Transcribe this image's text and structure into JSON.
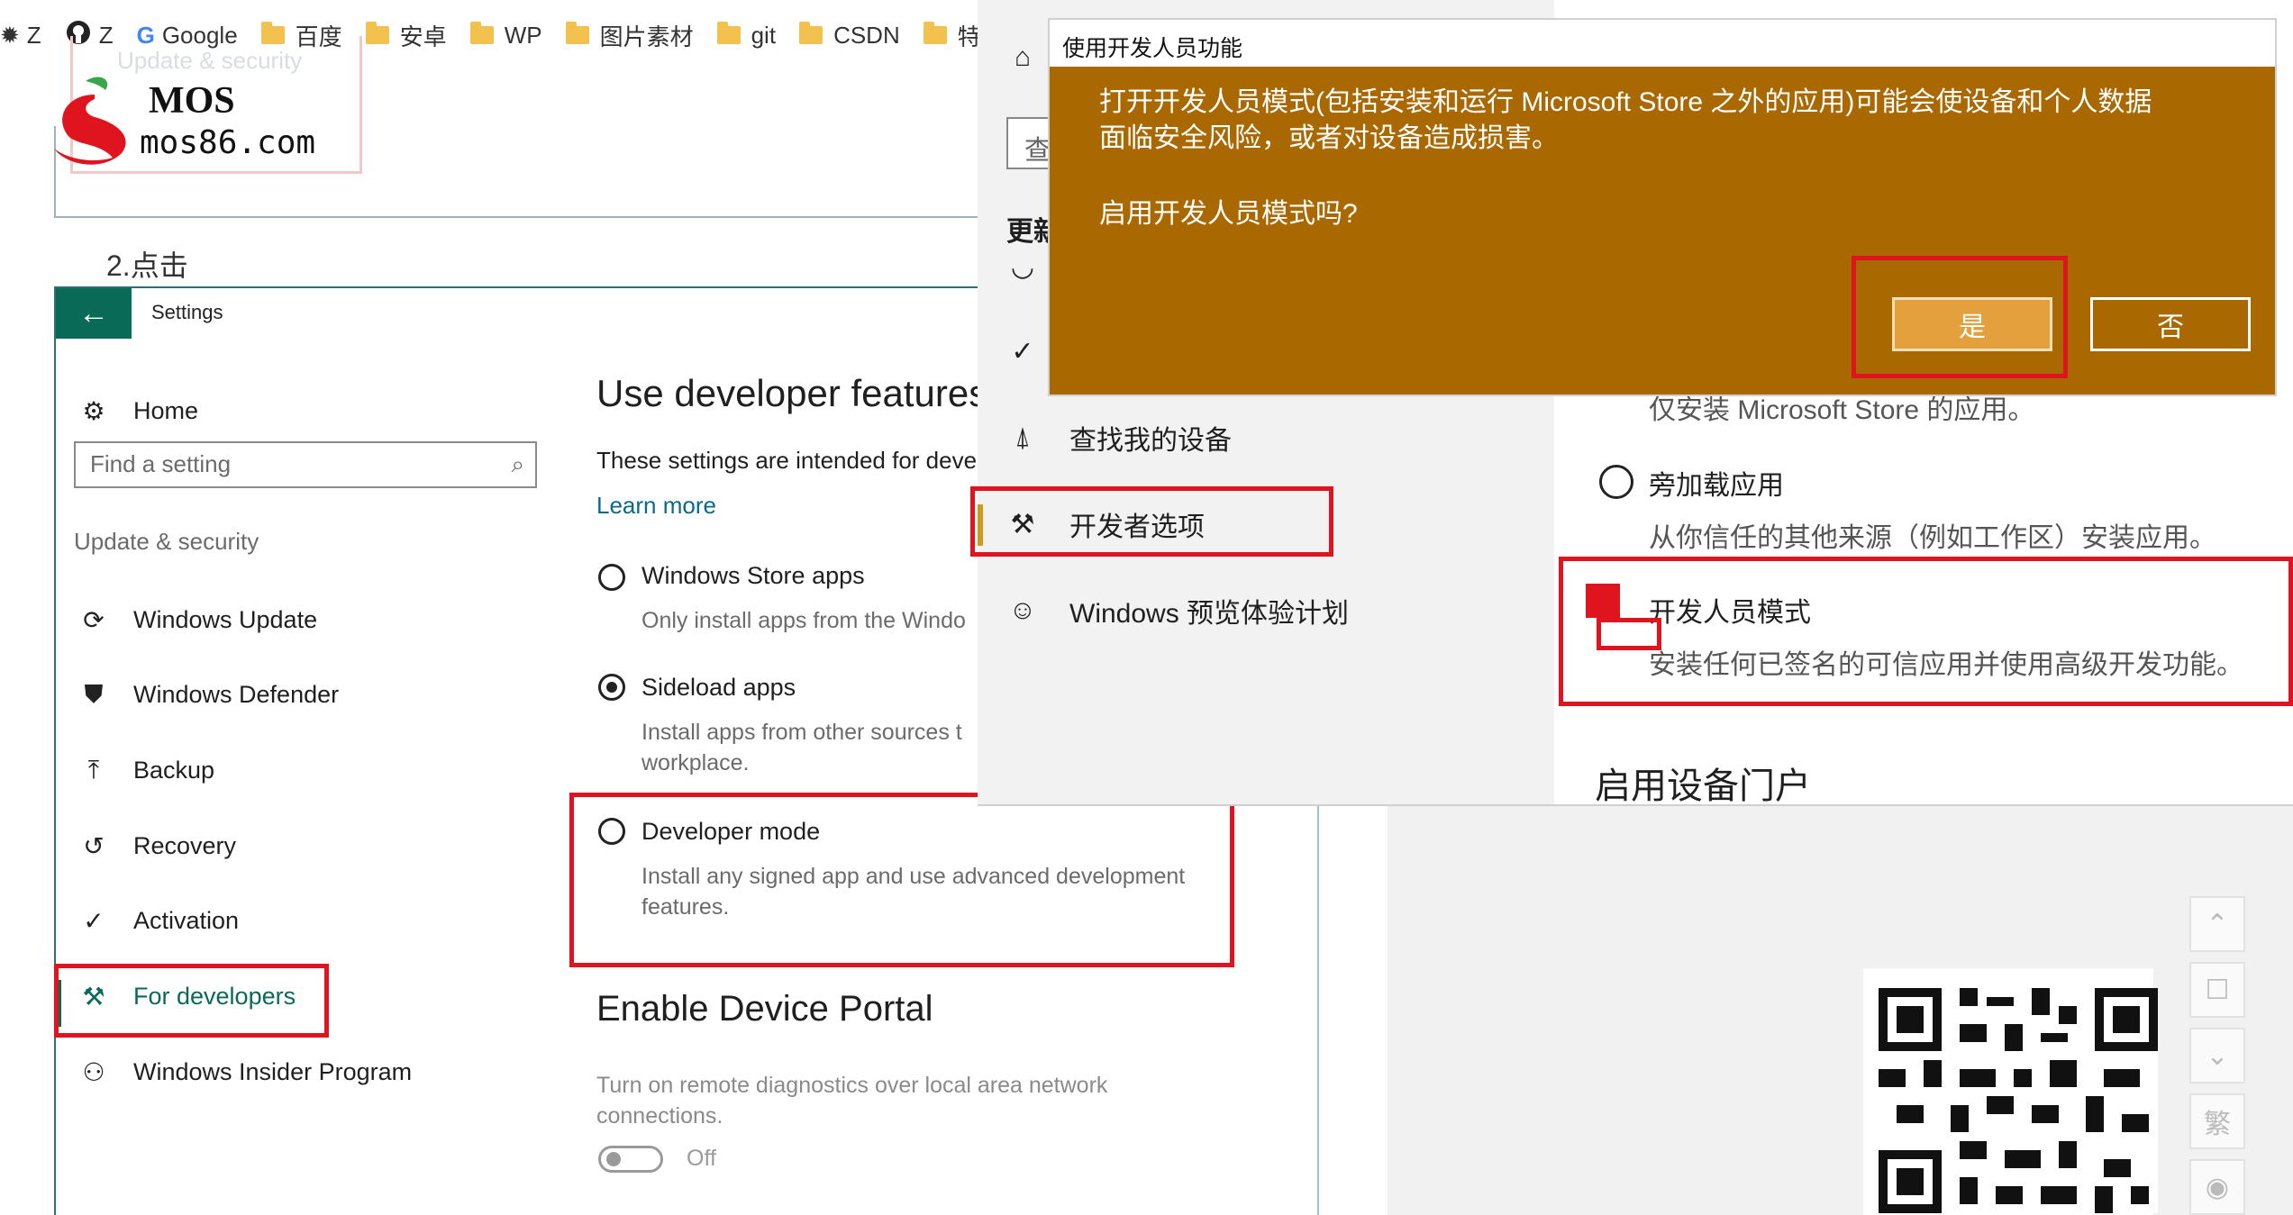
{
  "bookmarks": [
    {
      "label": "Z",
      "icon": "gear-icon"
    },
    {
      "label": "Z",
      "icon": "github-icon"
    },
    {
      "label": "Google",
      "icon": "google-icon"
    },
    {
      "label": "百度",
      "icon": "folder-icon"
    },
    {
      "label": "安卓",
      "icon": "folder-icon"
    },
    {
      "label": "WP",
      "icon": "folder-icon"
    },
    {
      "label": "图片素材",
      "icon": "folder-icon"
    },
    {
      "label": "git",
      "icon": "folder-icon"
    },
    {
      "label": "CSDN",
      "icon": "folder-icon"
    },
    {
      "label": "特效",
      "icon": "folder-icon"
    }
  ],
  "logo": {
    "brand": "MOS",
    "url": "mos86.com",
    "ghost_text": "Update & security"
  },
  "step_label": "2.点击",
  "old_settings": {
    "title": "Settings",
    "home": "Home",
    "search_placeholder": "Find a setting",
    "section": "Update & security",
    "nav": [
      {
        "label": "Windows Update",
        "icon": "refresh-icon"
      },
      {
        "label": "Windows Defender",
        "icon": "shield-icon"
      },
      {
        "label": "Backup",
        "icon": "backup-icon"
      },
      {
        "label": "Recovery",
        "icon": "history-icon"
      },
      {
        "label": "Activation",
        "icon": "check-circle-icon"
      },
      {
        "label": "For developers",
        "icon": "tools-icon"
      },
      {
        "label": "Windows Insider Program",
        "icon": "person-icon"
      }
    ],
    "heading": "Use developer features",
    "description": "These settings are intended for deve",
    "learn_more": "Learn more",
    "options": [
      {
        "title": "Windows Store apps",
        "sub": "Only install apps from the Windo",
        "checked": false
      },
      {
        "title": "Sideload apps",
        "sub": "Install apps from other sources t",
        "sub2": "workplace.",
        "checked": true
      },
      {
        "title": "Developer mode",
        "sub": "Install any signed app and use advanced development",
        "sub2": "features.",
        "checked": false
      }
    ],
    "portal_title": "Enable Device Portal",
    "portal_desc": "Turn on remote diagnostics over local area network",
    "portal_desc2": "connections.",
    "toggle_label": "Off"
  },
  "new_settings": {
    "search_stub": "查",
    "section_stub": "更新",
    "nav": [
      {
        "label": "查找我的设备",
        "icon": "find-device-icon"
      },
      {
        "label": "开发者选项",
        "icon": "tools-icon"
      },
      {
        "label": "Windows 预览体验计划",
        "icon": "insider-cat-icon"
      }
    ],
    "opt_partial": "仅安装 Microsoft Store 的应用。",
    "opt_sideload": "旁加载应用",
    "opt_sideload_sub": "从你信任的其他来源（例如工作区）安装应用。",
    "opt_dev": "开发人员模式",
    "opt_dev_sub": "安装任何已签名的可信应用并使用高级开发功能。",
    "portal_title": "启用设备门户"
  },
  "dialog": {
    "title": "使用开发人员功能",
    "message_line1": "打开开发人员模式(包括安装和运行 Microsoft Store 之外的应用)可能会使设备和个人数据",
    "message_line2": "面临安全风险，或者对设备造成损害。",
    "question": "启用开发人员模式吗?",
    "yes": "是",
    "no": "否"
  },
  "side_buttons": {
    "traditional": "繁"
  },
  "colors": {
    "dialog_bg": "#a96800",
    "yes_button": "#e3a03c",
    "highlight_red": "#e0141e",
    "old_accent": "#0a6a58",
    "new_accent": "#d09a1a"
  }
}
